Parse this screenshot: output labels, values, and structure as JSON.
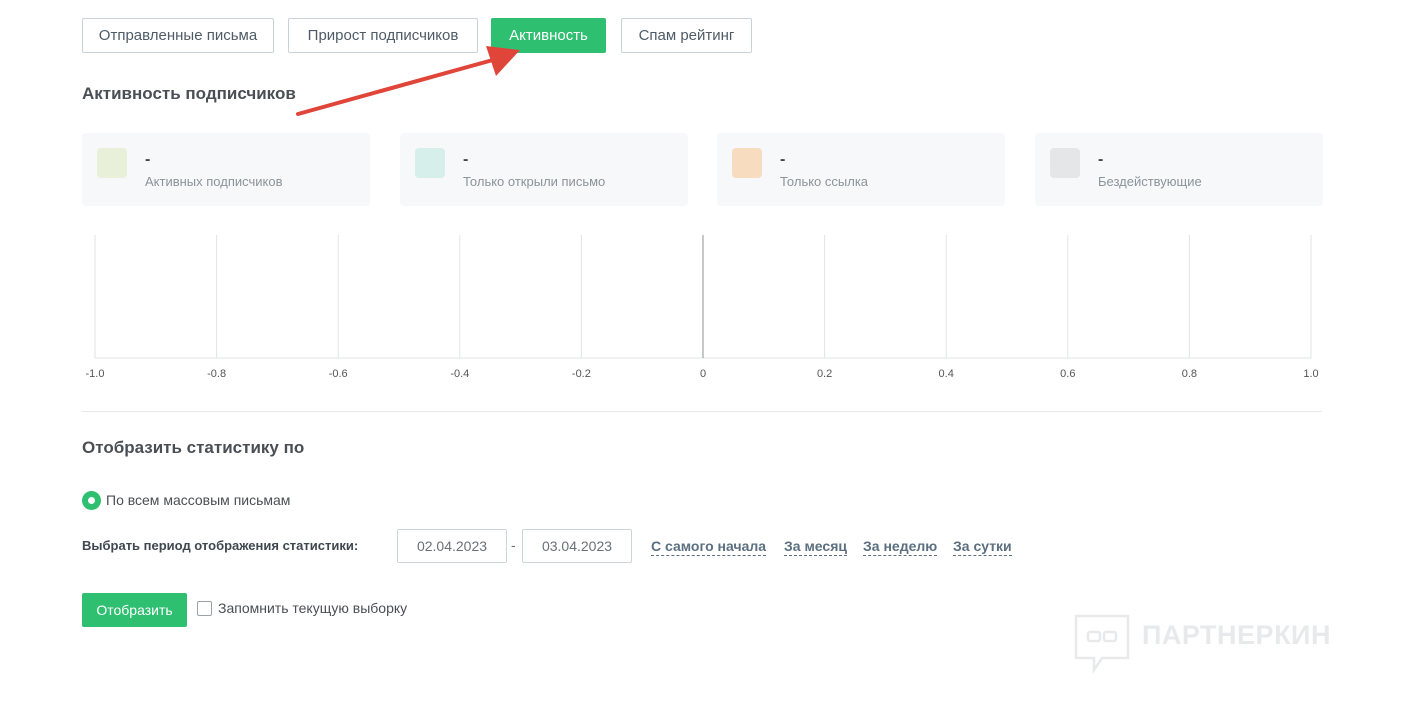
{
  "tabs": [
    {
      "label": "Отправленные письма",
      "active": false
    },
    {
      "label": "Прирост подписчиков",
      "active": false
    },
    {
      "label": "Активность",
      "active": true
    },
    {
      "label": "Спам рейтинг",
      "active": false
    }
  ],
  "activity": {
    "title": "Активность подписчиков",
    "cards": [
      {
        "value": "-",
        "label": "Активных подписчиков",
        "color": "#e9f0d9"
      },
      {
        "value": "-",
        "label": "Только открыли письмо",
        "color": "#d6efeb"
      },
      {
        "value": "-",
        "label": "Только ссылка",
        "color": "#f8dcbf"
      },
      {
        "value": "-",
        "label": "Бездействующие",
        "color": "#e4e6e8"
      }
    ]
  },
  "chart_data": {
    "type": "bar",
    "xlim": [
      -1.0,
      1.0
    ],
    "xticks": [
      "-1.0",
      "-0.8",
      "-0.6",
      "-0.4",
      "-0.2",
      "0",
      "0.2",
      "0.4",
      "0.6",
      "0.8",
      "1.0"
    ],
    "series": [],
    "grid": true
  },
  "filters": {
    "title": "Отобразить статистику по",
    "radio_label": "По всем массовым письмам",
    "period_label": "Выбрать период отображения статистики:",
    "date_from": "02.04.2023",
    "date_separator": "-",
    "date_to": "03.04.2023",
    "quick_links": [
      "С самого начала",
      "За месяц",
      "За неделю",
      "За сутки"
    ],
    "submit_label": "Отобразить",
    "remember_label": "Запомнить текущую выборку"
  },
  "watermark": {
    "text": "ПАРТНЕРКИН"
  },
  "colors": {
    "accent": "#2fbf71",
    "annotation_arrow": "#e0453a"
  }
}
